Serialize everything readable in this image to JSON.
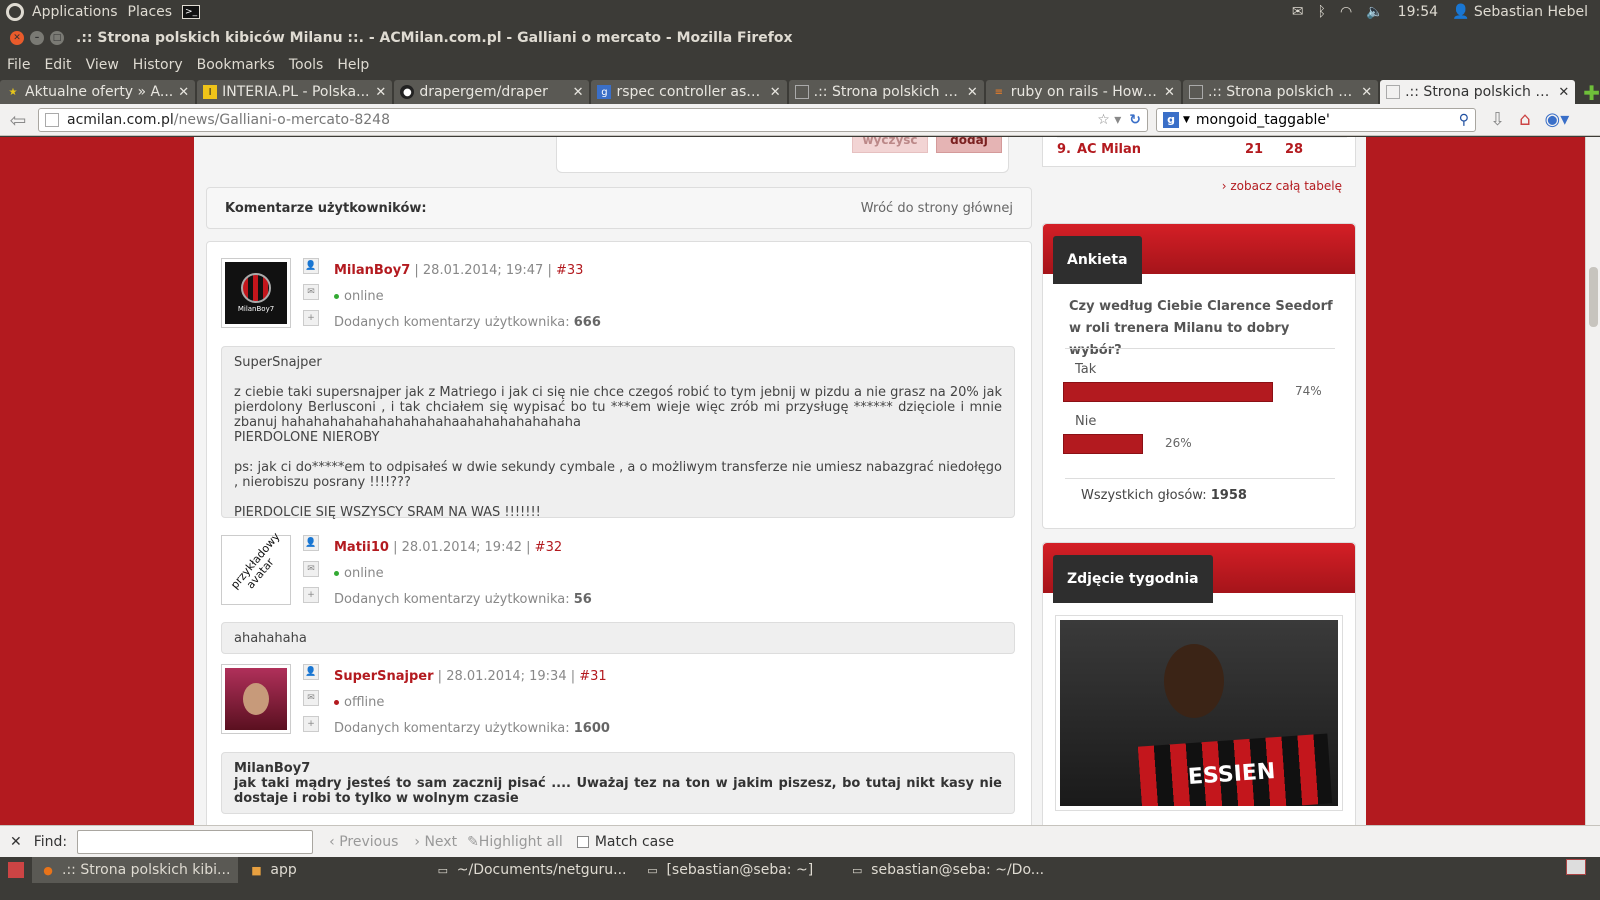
{
  "top_panel": {
    "applications": "Applications",
    "places": "Places",
    "clock": "19:54",
    "user": "Sebastian Hebel"
  },
  "window": {
    "title": ".:: Strona polskich kibiców Milanu ::. - ACMilan.com.pl - Galliani o mercato - Mozilla Firefox"
  },
  "menubar": {
    "items": [
      "File",
      "Edit",
      "View",
      "History",
      "Bookmarks",
      "Tools",
      "Help"
    ]
  },
  "tabs": [
    {
      "label": "Aktualne oferty » A...",
      "icon": "star-icon"
    },
    {
      "label": "INTERIA.PL - Polska...",
      "icon": "interia-icon"
    },
    {
      "label": "drapergem/draper",
      "icon": "github-icon"
    },
    {
      "label": "rspec controller ass...",
      "icon": "google-icon"
    },
    {
      "label": ".:: Strona polskich k...",
      "icon": "page-icon"
    },
    {
      "label": "ruby on rails - How ...",
      "icon": "stackoverflow-icon"
    },
    {
      "label": ".:: Strona polskich k...",
      "icon": "page-icon"
    },
    {
      "label": ".:: Strona polskich k...",
      "icon": "page-icon",
      "active": true
    }
  ],
  "navbar": {
    "url_host": "acmilan.com.pl",
    "url_path": "/news/Galliani-o-mercato-8248",
    "search_value": "mongoid_taggable'"
  },
  "page": {
    "poll_form_buttons": {
      "clear": "wyczyść",
      "add": "dodaj"
    },
    "comments_header": "Komentarze użytkowników:",
    "back_link": "Wróć do strony głównej",
    "comments": [
      {
        "user": "MilanBoy7",
        "date": "28.01.2014; 19:47",
        "number": "#33",
        "status": "online",
        "count_label": "Dodanych komentarzy użytkownika:",
        "count": "666",
        "avatar_label": "MilanBoy7",
        "body_quote_user": "SuperSnajper",
        "body_lines": [
          "z ciebie taki supersnajper jak z Matriego i jak ci się nie chce czegoś robić to tym jebnij w pizdu a nie grasz na 20% jak pierdolony Berlusconi , i tak chciałem się wypisać bo tu ***em wieje więc zrób mi przysługę ****** dzięciole i mnie zbanuj hahahahahahahahahahahaahahahahahahaha",
          "PIERDOLONE NIEROBY",
          "ps: jak ci do*****em to odpisałeś w dwie sekundy cymbale , a o możliwym transferze nie umiesz nabazgrać niedołęgo , nierobiszu posrany !!!!???",
          "PIERDOLCIE SIĘ WSZYSCY SRAM NA WAS !!!!!!!"
        ]
      },
      {
        "user": "Matii10",
        "date": "28.01.2014; 19:42",
        "number": "#32",
        "status": "online",
        "count_label": "Dodanych komentarzy użytkownika:",
        "count": "56",
        "avatar_label": "przykładowy avatar",
        "body": "ahahahaha"
      },
      {
        "user": "SuperSnajper",
        "date": "28.01.2014; 19:34",
        "number": "#31",
        "status": "offline",
        "count_label": "Dodanych komentarzy użytkownika:",
        "count": "1600",
        "body_quote_user": "MilanBoy7",
        "body_bold": "jak taki mądry jesteś to sam zacznij pisać .... Uważaj tez na ton w jakim piszesz, bo tutaj nikt kasy nie dostaje i robi to tylko w wolnym czasie"
      }
    ]
  },
  "sidebar": {
    "table_row": {
      "pos": "9.",
      "team": "AC Milan",
      "played": "21",
      "points": "28"
    },
    "see_table": "zobacz całą tabelę",
    "poll": {
      "title": "Ankieta",
      "question": "Czy według Ciebie Clarence Seedorf w roli trenera Milanu to dobry wybór?",
      "options": [
        {
          "label": "Tak",
          "percent": "74%",
          "value": 74
        },
        {
          "label": "Nie",
          "percent": "26%",
          "value": 26
        }
      ],
      "total_label": "Wszystkich głosów:",
      "total": "1958"
    },
    "photo": {
      "title": "Zdjęcie tygodnia",
      "shirt_text": "ESSIEN"
    }
  },
  "findbar": {
    "label": "Find:",
    "value": "",
    "previous": "Previous",
    "next": "Next",
    "highlight": "Highlight all",
    "match_case": "Match case"
  },
  "taskbar": [
    {
      "label": ".:: Strona polskich kibi...",
      "icon": "firefox-icon",
      "active": true
    },
    {
      "label": "app",
      "icon": "folder-icon"
    },
    {
      "label": "~/Documents/netguru...",
      "icon": "terminal-icon"
    },
    {
      "label": "[sebastian@seba: ~]",
      "icon": "terminal-icon"
    },
    {
      "label": "sebastian@seba: ~/Do...",
      "icon": "terminal-icon"
    }
  ]
}
